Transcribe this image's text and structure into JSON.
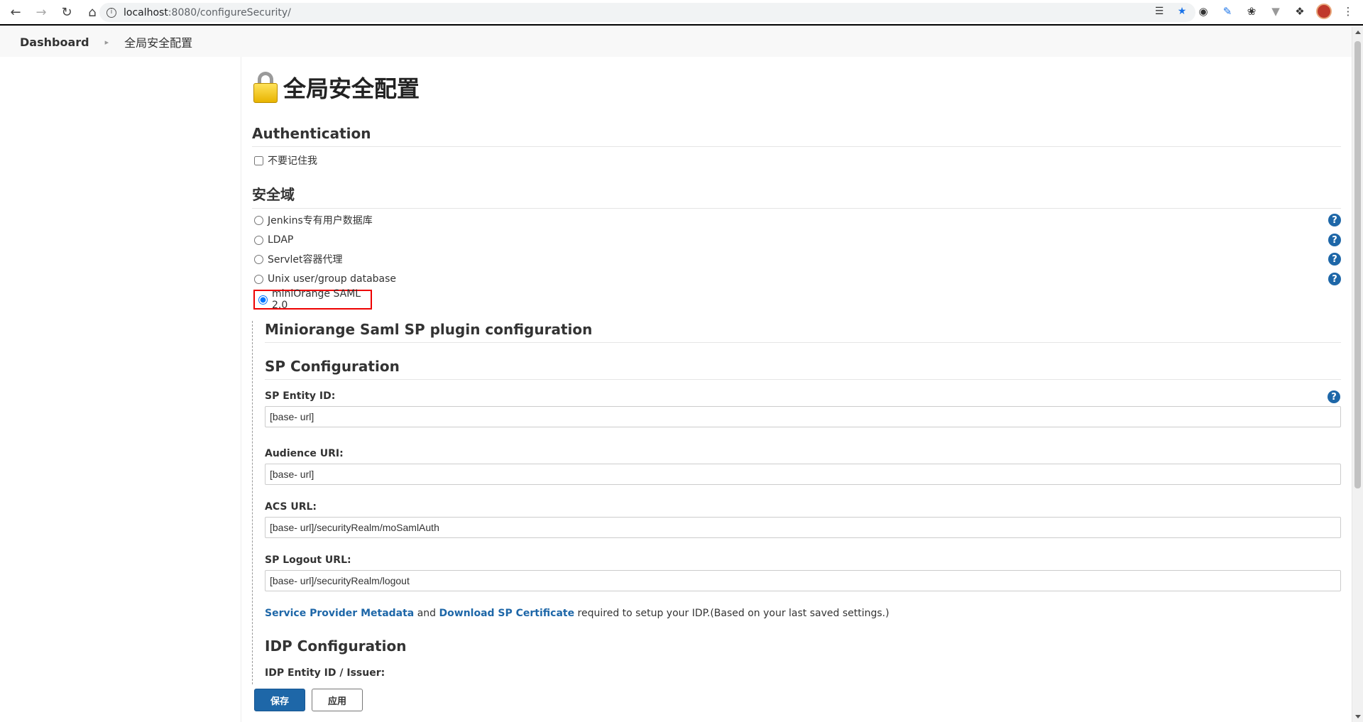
{
  "browser": {
    "url_host": "localhost",
    "url_rest": ":8080/configureSecurity/"
  },
  "breadcrumb": {
    "root": "Dashboard",
    "current": "全局安全配置"
  },
  "page": {
    "title": "全局安全配置"
  },
  "authentication": {
    "header": "Authentication",
    "dont_remember_label": "不要记住我"
  },
  "security_realm": {
    "header": "安全域",
    "options": [
      {
        "label": "Jenkins专有用户数据库",
        "selected": false
      },
      {
        "label": "LDAP",
        "selected": false
      },
      {
        "label": "Servlet容器代理",
        "selected": false
      },
      {
        "label": "Unix user/group database",
        "selected": false
      },
      {
        "label": "miniOrange SAML 2.0",
        "selected": true
      }
    ]
  },
  "saml": {
    "plugin_header": "Miniorange Saml SP plugin configuration",
    "sp_header": "SP Configuration",
    "sp_entity_id_label": "SP Entity ID:",
    "sp_entity_id_value": "[base- url]",
    "audience_uri_label": "Audience URI:",
    "audience_uri_value": "[base- url]",
    "acs_url_label": "ACS URL:",
    "acs_url_value": "[base- url]/securityRealm/moSamlAuth",
    "sp_logout_url_label": "SP Logout URL:",
    "sp_logout_url_value": "[base- url]/securityRealm/logout",
    "metadata_link": "Service Provider Metadata",
    "and_text": " and ",
    "certificate_link": "Download SP Certificate",
    "required_text": " required to setup your IDP.(Based on your last saved settings.)",
    "idp_header": "IDP Configuration",
    "idp_entity_label": "IDP Entity ID / Issuer:"
  },
  "buttons": {
    "save": "保存",
    "apply": "应用"
  }
}
